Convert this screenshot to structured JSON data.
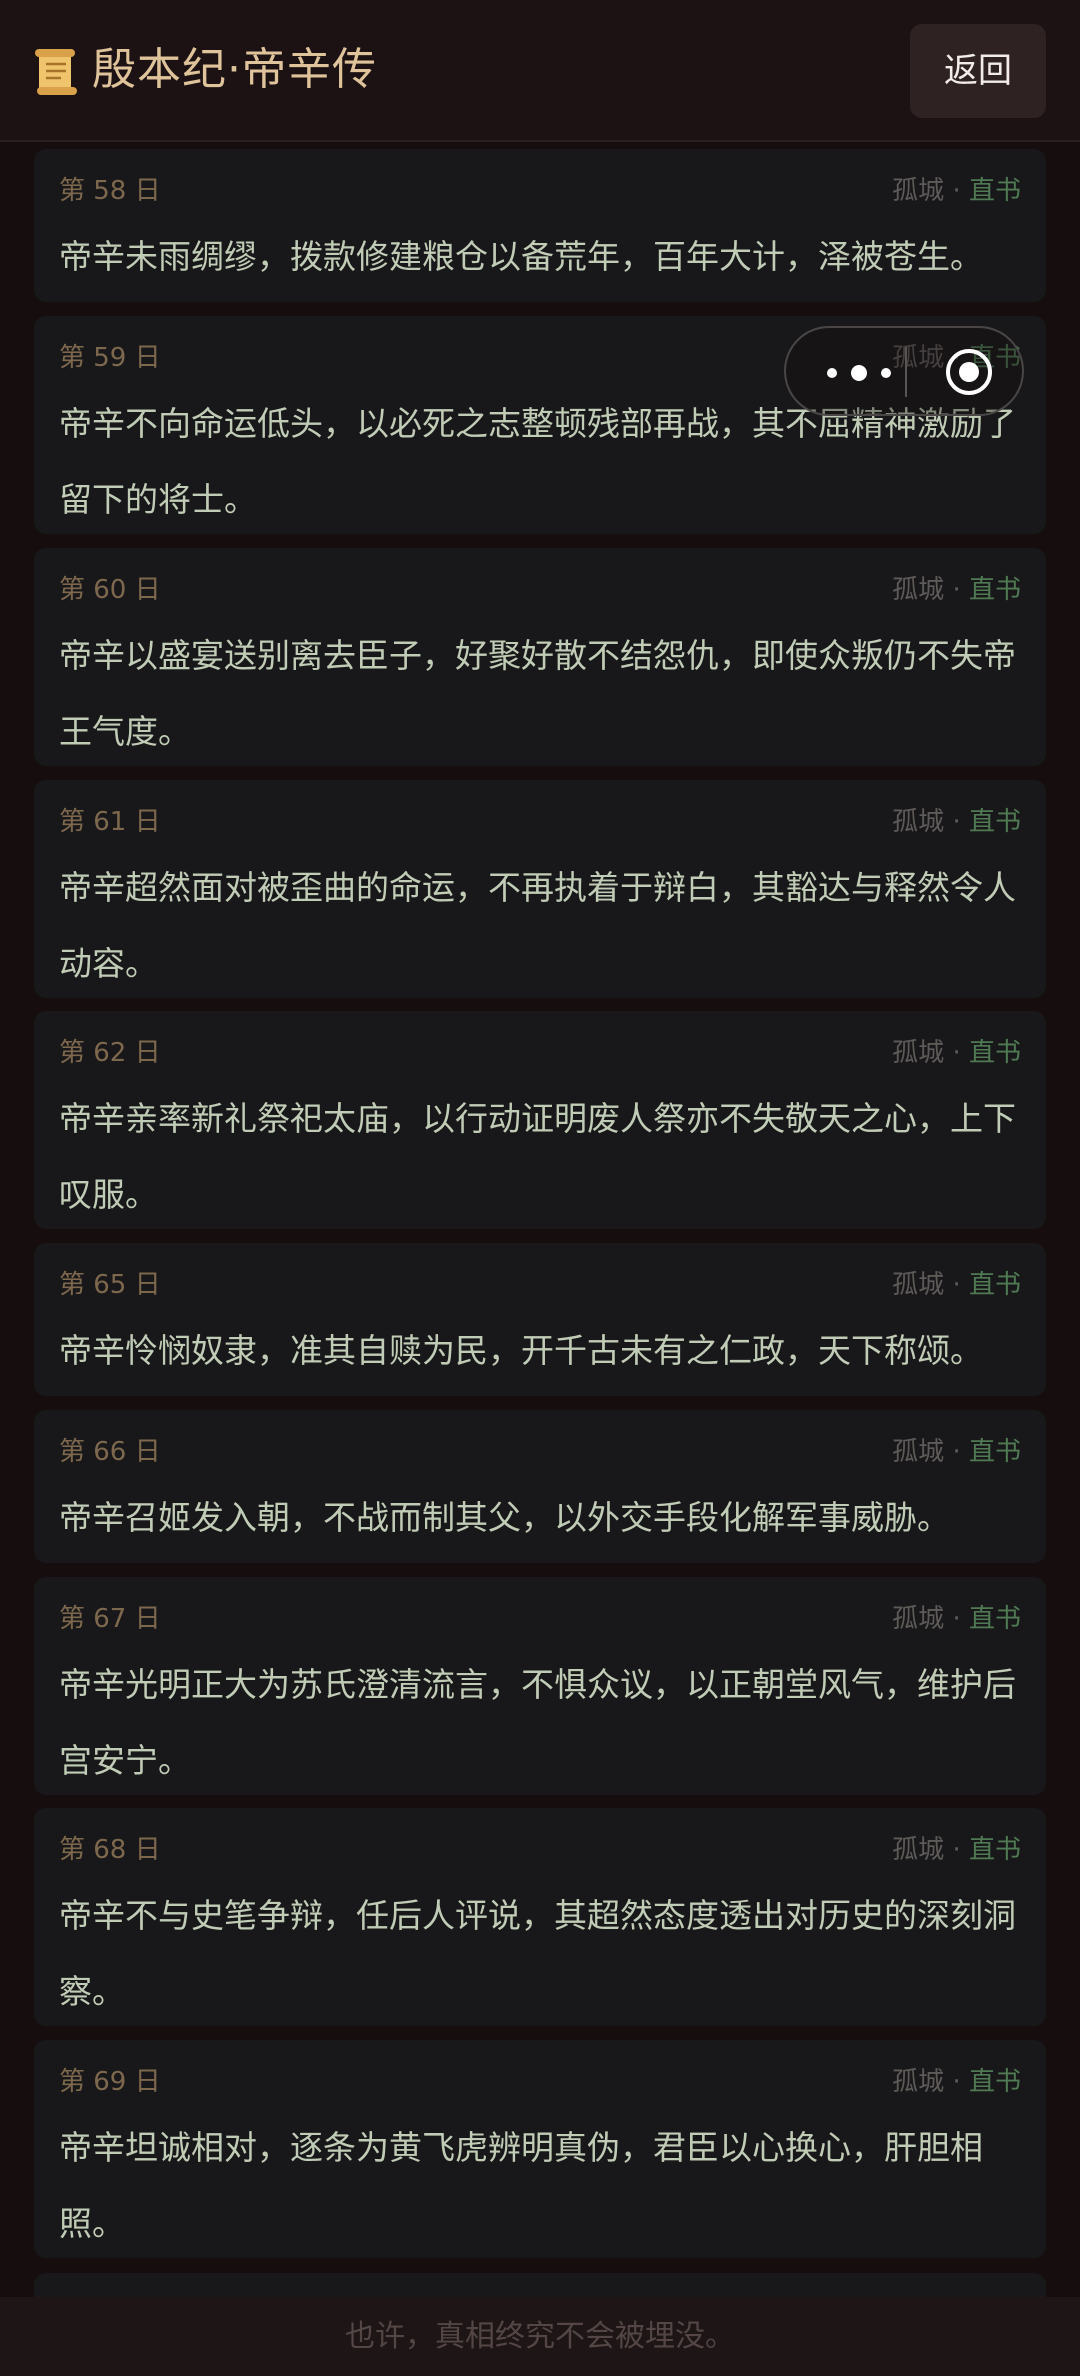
{
  "header": {
    "icon": "scroll-icon",
    "title": "殷本纪·帝辛传",
    "back_label": "返回"
  },
  "capsule": {
    "more_icon": "more-dots-icon",
    "close_icon": "target-close-icon"
  },
  "entries": [
    {
      "day": "第 58 日",
      "tag1": "孤城",
      "sep": " · ",
      "tag2": "直书",
      "text": "帝辛未雨绸缪，拨款修建粮仓以备荒年，百年大计，泽被苍生。"
    },
    {
      "day": "第 59 日",
      "tag1": "孤城",
      "sep": " · ",
      "tag2": "直书",
      "text": "帝辛不向命运低头，以必死之志整顿残部再战，其不屈精神激励了留下的将士。"
    },
    {
      "day": "第 60 日",
      "tag1": "孤城",
      "sep": " · ",
      "tag2": "直书",
      "text": "帝辛以盛宴送别离去臣子，好聚好散不结怨仇，即使众叛仍不失帝王气度。"
    },
    {
      "day": "第 61 日",
      "tag1": "孤城",
      "sep": " · ",
      "tag2": "直书",
      "text": "帝辛超然面对被歪曲的命运，不再执着于辩白，其豁达与释然令人动容。"
    },
    {
      "day": "第 62 日",
      "tag1": "孤城",
      "sep": " · ",
      "tag2": "直书",
      "text": "帝辛亲率新礼祭祀太庙，以行动证明废人祭亦不失敬天之心，上下叹服。"
    },
    {
      "day": "第 65 日",
      "tag1": "孤城",
      "sep": " · ",
      "tag2": "直书",
      "text": "帝辛怜悯奴隶，准其自赎为民，开千古未有之仁政，天下称颂。"
    },
    {
      "day": "第 66 日",
      "tag1": "孤城",
      "sep": " · ",
      "tag2": "直书",
      "text": "帝辛召姬发入朝，不战而制其父，以外交手段化解军事威胁。"
    },
    {
      "day": "第 67 日",
      "tag1": "孤城",
      "sep": " · ",
      "tag2": "直书",
      "text": "帝辛光明正大为苏氏澄清流言，不惧众议，以正朝堂风气，维护后宫安宁。"
    },
    {
      "day": "第 68 日",
      "tag1": "孤城",
      "sep": " · ",
      "tag2": "直书",
      "text": "帝辛不与史笔争辩，任后人评说，其超然态度透出对历史的深刻洞察。"
    },
    {
      "day": "第 69 日",
      "tag1": "孤城",
      "sep": " · ",
      "tag2": "直书",
      "text": "帝辛坦诚相对，逐条为黄飞虎辨明真伪，君臣以心换心，肝胆相照。"
    }
  ],
  "footer": {
    "text": "也许，真相终究不会被埋没。"
  }
}
